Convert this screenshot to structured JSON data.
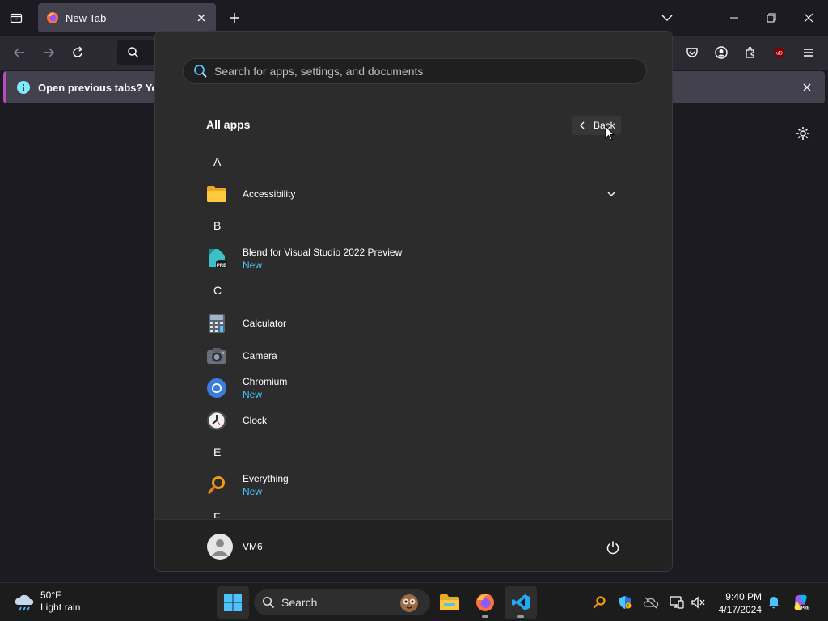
{
  "browser": {
    "tab_title": "New Tab",
    "notification": "Open previous tabs? You ca"
  },
  "start_menu": {
    "search_placeholder": "Search for apps, settings, and documents",
    "all_apps_label": "All apps",
    "back_label": "Back",
    "sections": [
      {
        "letter": "A",
        "apps": [
          {
            "name": "Accessibility",
            "badge": "",
            "icon": "folder-icon",
            "expandable": true
          }
        ]
      },
      {
        "letter": "B",
        "apps": [
          {
            "name": "Blend for Visual Studio 2022 Preview",
            "badge": "New",
            "icon": "blend-icon"
          }
        ]
      },
      {
        "letter": "C",
        "apps": [
          {
            "name": "Calculator",
            "badge": "",
            "icon": "calculator-icon"
          },
          {
            "name": "Camera",
            "badge": "",
            "icon": "camera-icon"
          },
          {
            "name": "Chromium",
            "badge": "New",
            "icon": "chromium-icon"
          },
          {
            "name": "Clock",
            "badge": "",
            "icon": "clock-icon"
          }
        ]
      },
      {
        "letter": "E",
        "apps": [
          {
            "name": "Everything",
            "badge": "New",
            "icon": "everything-icon"
          }
        ]
      },
      {
        "letter": "F",
        "apps": []
      }
    ],
    "user_name": "VM6"
  },
  "taskbar": {
    "weather_temp": "50°F",
    "weather_desc": "Light rain",
    "search_label": "Search",
    "time": "9:40 PM",
    "date": "4/17/2024"
  },
  "colors": {
    "accent_blue": "#4cc2ff",
    "start_bg": "#2c2c2c",
    "taskbar_bg": "#1c1c1c"
  }
}
